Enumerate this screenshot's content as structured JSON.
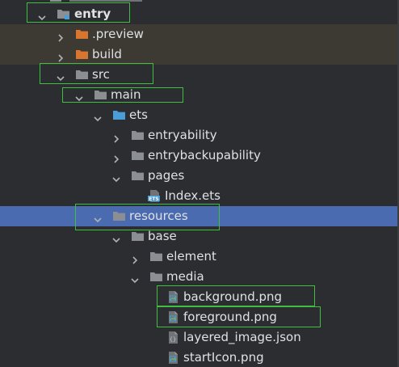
{
  "tree": {
    "items": [
      {
        "label": "entry",
        "expanded": true,
        "type": "module",
        "bold": true,
        "row_state": "normal"
      },
      {
        "label": ".preview",
        "expanded": false,
        "type": "folder-excluded",
        "bold": false,
        "row_state": "excluded"
      },
      {
        "label": "build",
        "expanded": false,
        "type": "folder-excluded",
        "bold": false,
        "row_state": "excluded"
      },
      {
        "label": "src",
        "expanded": true,
        "type": "folder",
        "bold": false,
        "row_state": "normal"
      },
      {
        "label": "main",
        "expanded": true,
        "type": "folder",
        "bold": false,
        "row_state": "normal"
      },
      {
        "label": "ets",
        "expanded": true,
        "type": "folder-source",
        "bold": false,
        "row_state": "normal"
      },
      {
        "label": "entryability",
        "expanded": false,
        "type": "folder",
        "bold": false,
        "row_state": "normal"
      },
      {
        "label": "entrybackupability",
        "expanded": false,
        "type": "folder",
        "bold": false,
        "row_state": "normal"
      },
      {
        "label": "pages",
        "expanded": true,
        "type": "folder",
        "bold": false,
        "row_state": "normal"
      },
      {
        "label": "Index.ets",
        "type": "ets-file",
        "bold": false,
        "row_state": "normal"
      },
      {
        "label": "resources",
        "expanded": true,
        "type": "folder",
        "bold": false,
        "row_state": "selected"
      },
      {
        "label": "base",
        "expanded": true,
        "type": "folder",
        "bold": false,
        "row_state": "normal"
      },
      {
        "label": "element",
        "expanded": false,
        "type": "folder",
        "bold": false,
        "row_state": "normal"
      },
      {
        "label": "media",
        "expanded": true,
        "type": "folder",
        "bold": false,
        "row_state": "normal"
      },
      {
        "label": "background.png",
        "type": "image-file",
        "bold": false,
        "row_state": "normal"
      },
      {
        "label": "foreground.png",
        "type": "image-file",
        "bold": false,
        "row_state": "normal"
      },
      {
        "label": "layered_image.json",
        "type": "json-file",
        "bold": false,
        "row_state": "normal"
      },
      {
        "label": "startIcon.png",
        "type": "image-file",
        "bold": false,
        "row_state": "normal"
      }
    ],
    "highlighted": [
      "entry",
      "src",
      "main",
      "resources",
      "background.png",
      "foreground.png"
    ]
  },
  "colors": {
    "background": "#2b2d30",
    "text": "#dfe1e5",
    "excluded_row": "#3c3a32",
    "selected_row": "#4a6bb0",
    "folder": "#8b8e93",
    "excluded_folder": "#d8752f",
    "source_folder": "#4a9dd6",
    "highlight_box": "#3fbf3f"
  }
}
